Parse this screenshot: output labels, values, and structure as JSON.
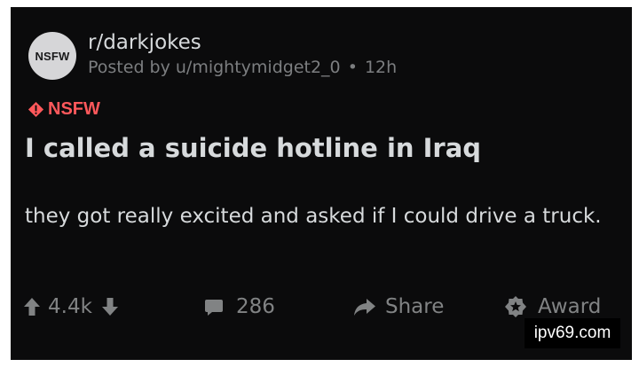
{
  "post": {
    "avatar_label": "NSFW",
    "subreddit": "r/darkjokes",
    "posted_by": "Posted by u/mightymidget2_0",
    "separator": "•",
    "age": "12h",
    "flair": "NSFW",
    "title": "I called a suicide hotline in Iraq",
    "body": "they got really excited and asked if I could drive a truck."
  },
  "actions": {
    "vote_count": "4.4k",
    "comment_count": "286",
    "share_label": "Share",
    "award_label": "Award"
  },
  "watermark": "ipv69.com",
  "icons": {
    "upvote": "arrow-up-icon",
    "downvote": "arrow-down-icon",
    "comments": "comment-bubble-icon",
    "share": "share-arrow-icon",
    "award": "award-badge-icon",
    "nsfw": "warning-diamond-icon"
  },
  "colors": {
    "background": "#0b0b0c",
    "text": "#d7dadc",
    "muted": "#7c7e80",
    "nsfw": "#ff585b"
  }
}
